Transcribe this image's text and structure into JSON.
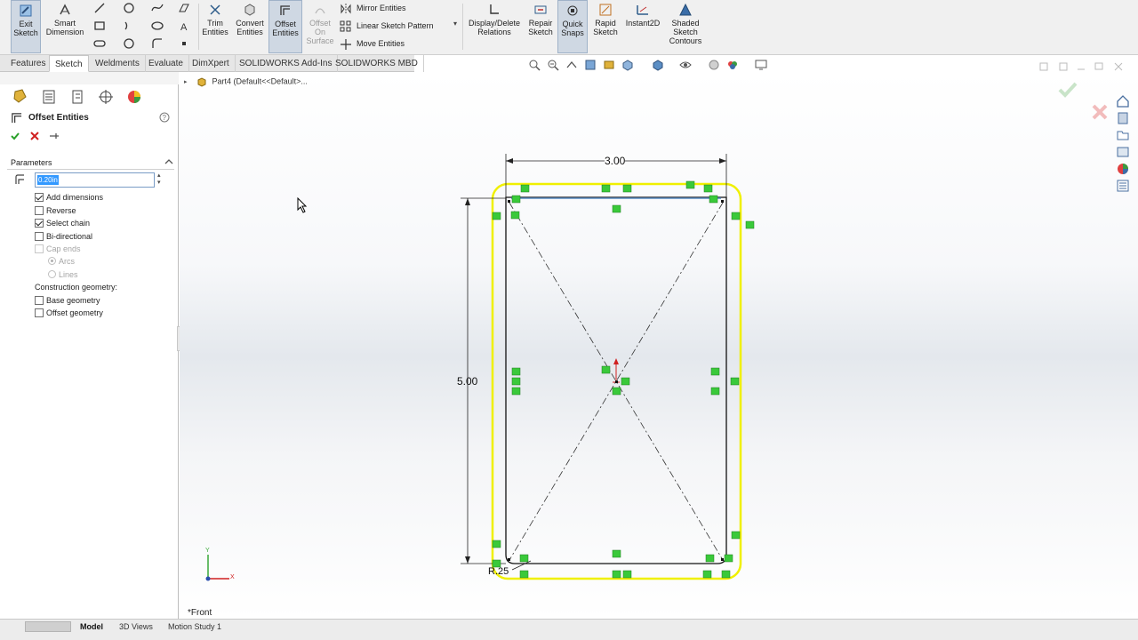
{
  "ribbon": {
    "exit_sketch": "Exit Sketch",
    "smart_dimension": "Smart Dimension",
    "trim_entities": "Trim Entities",
    "convert_entities": "Convert Entities",
    "offset_entities": "Offset Entities",
    "offset_on_surface": "Offset On Surface",
    "mirror_entities": "Mirror Entities",
    "linear_sketch_pattern": "Linear Sketch Pattern",
    "move_entities": "Move Entities",
    "display_delete_relations": "Display/Delete Relations",
    "repair_sketch": "Repair Sketch",
    "quick_snaps": "Quick Snaps",
    "rapid_sketch": "Rapid Sketch",
    "instant2d": "Instant2D",
    "shaded_sketch_contours": "Shaded Sketch Contours"
  },
  "tabs": [
    "Features",
    "Sketch",
    "Weldments",
    "Evaluate",
    "DimXpert",
    "SOLIDWORKS Add-Ins",
    "SOLIDWORKS MBD"
  ],
  "active_tab": "Sketch",
  "property_manager": {
    "title": "Offset Entities",
    "parameters_label": "Parameters",
    "offset_value": "0.20in",
    "options": [
      {
        "label": "Add dimensions",
        "checked": true
      },
      {
        "label": "Reverse",
        "checked": false
      },
      {
        "label": "Select chain",
        "checked": true
      },
      {
        "label": "Bi-directional",
        "checked": false
      }
    ],
    "cap_ends_label": "Cap ends",
    "cap_options": [
      "Arcs",
      "Lines"
    ],
    "construction_label": "Construction geometry:",
    "construction_options": [
      {
        "label": "Base geometry",
        "checked": false
      },
      {
        "label": "Offset geometry",
        "checked": false
      }
    ]
  },
  "feature_tree": {
    "part_name": "Part4  (Default<<Default>..."
  },
  "sketch": {
    "dimension_width": "3.00",
    "dimension_height": "5.00",
    "radius_label": "R.25",
    "view_label": "*Front"
  },
  "bottom_tabs": [
    "Model",
    "3D Views",
    "Motion Study 1"
  ],
  "active_bottom_tab": "Model",
  "colors": {
    "offset_outline": "#f0f000",
    "relation_marker": "#3ac93a",
    "selection_blue": "#3399ff"
  }
}
